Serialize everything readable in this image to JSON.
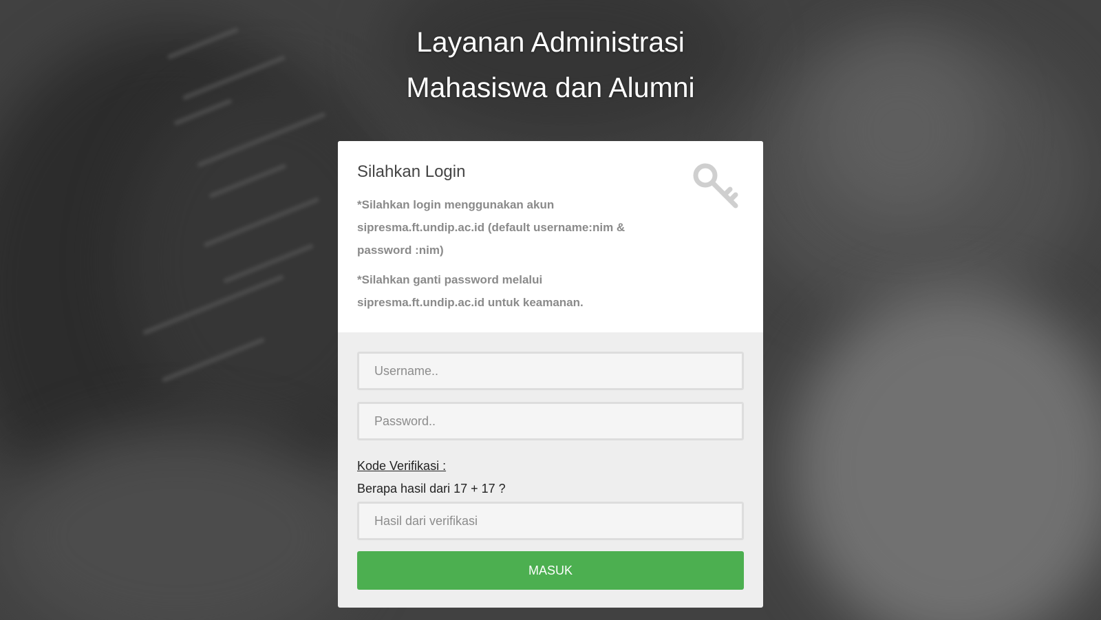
{
  "header": {
    "title_line1": "Layanan Administrasi",
    "title_line2": "Mahasiswa dan Alumni"
  },
  "login": {
    "heading": "Silahkan Login",
    "note1": "*Silahkan login menggunakan akun sipresma.ft.undip.ac.id (default username:nim & password :nim)",
    "note2": "*Silahkan ganti password melalui sipresma.ft.undip.ac.id untuk keamanan.",
    "icon": "key-icon",
    "username_placeholder": "Username..",
    "username_value": "",
    "password_placeholder": "Password..",
    "password_value": "",
    "verification_label": "Kode Verifikasi :",
    "verification_question": "Berapa hasil dari 17 + 17 ?",
    "verification_placeholder": "Hasil dari verifikasi",
    "verification_value": "",
    "submit_label": "MASUK"
  },
  "colors": {
    "accent": "#4caf50",
    "card_header_bg": "#ffffff",
    "card_body_bg": "#eeeeee",
    "note_text": "#8a8a8a"
  }
}
